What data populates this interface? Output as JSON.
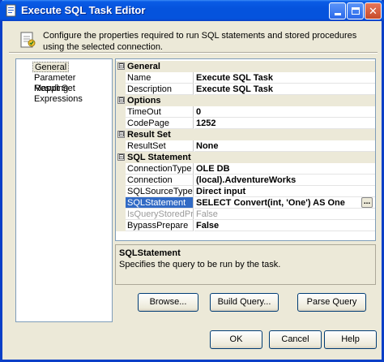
{
  "window": {
    "title": "Execute SQL Task Editor"
  },
  "header": {
    "description": "Configure the properties required to run SQL statements and stored procedures using the selected connection."
  },
  "nav": {
    "items": [
      {
        "label": "General",
        "selected": true
      },
      {
        "label": "Parameter Mapping",
        "selected": false
      },
      {
        "label": "Result Set",
        "selected": false
      },
      {
        "label": "Expressions",
        "selected": false
      }
    ]
  },
  "grid": {
    "general": {
      "label": "General",
      "expander": "⊟",
      "name": {
        "name": "Name",
        "value": "Execute SQL Task"
      },
      "description": {
        "name": "Description",
        "value": "Execute SQL Task"
      }
    },
    "options": {
      "label": "Options",
      "expander": "⊟",
      "timeout": {
        "name": "TimeOut",
        "value": "0"
      },
      "codepage": {
        "name": "CodePage",
        "value": "1252"
      }
    },
    "result_set": {
      "label": "Result Set",
      "expander": "⊟",
      "result_set": {
        "name": "ResultSet",
        "value": "None"
      }
    },
    "sql_statement": {
      "label": "SQL Statement",
      "expander": "⊟",
      "connection_type": {
        "name": "ConnectionType",
        "value": "OLE DB"
      },
      "connection": {
        "name": "Connection",
        "value": "(local).AdventureWorks"
      },
      "source_type": {
        "name": "SQLSourceType",
        "value": "Direct input"
      },
      "statement": {
        "name": "SQLStatement",
        "value": "SELECT Convert(int, 'One') AS One",
        "ellipsis": "..."
      },
      "is_stored_proc": {
        "name": "IsQueryStoredProce",
        "value": "False"
      },
      "bypass_prepare": {
        "name": "BypassPrepare",
        "value": "False"
      }
    }
  },
  "description_pane": {
    "title": "SQLStatement",
    "text": "Specifies the query to be run by the task."
  },
  "buttons": {
    "browse": "Browse...",
    "build_query": "Build Query...",
    "parse_query": "Parse Query",
    "ok": "OK",
    "cancel": "Cancel",
    "help": "Help"
  },
  "colors": {
    "titlebar": "#0553dd",
    "selection": "#316ac5",
    "dialog_bg": "#ece9d8"
  }
}
